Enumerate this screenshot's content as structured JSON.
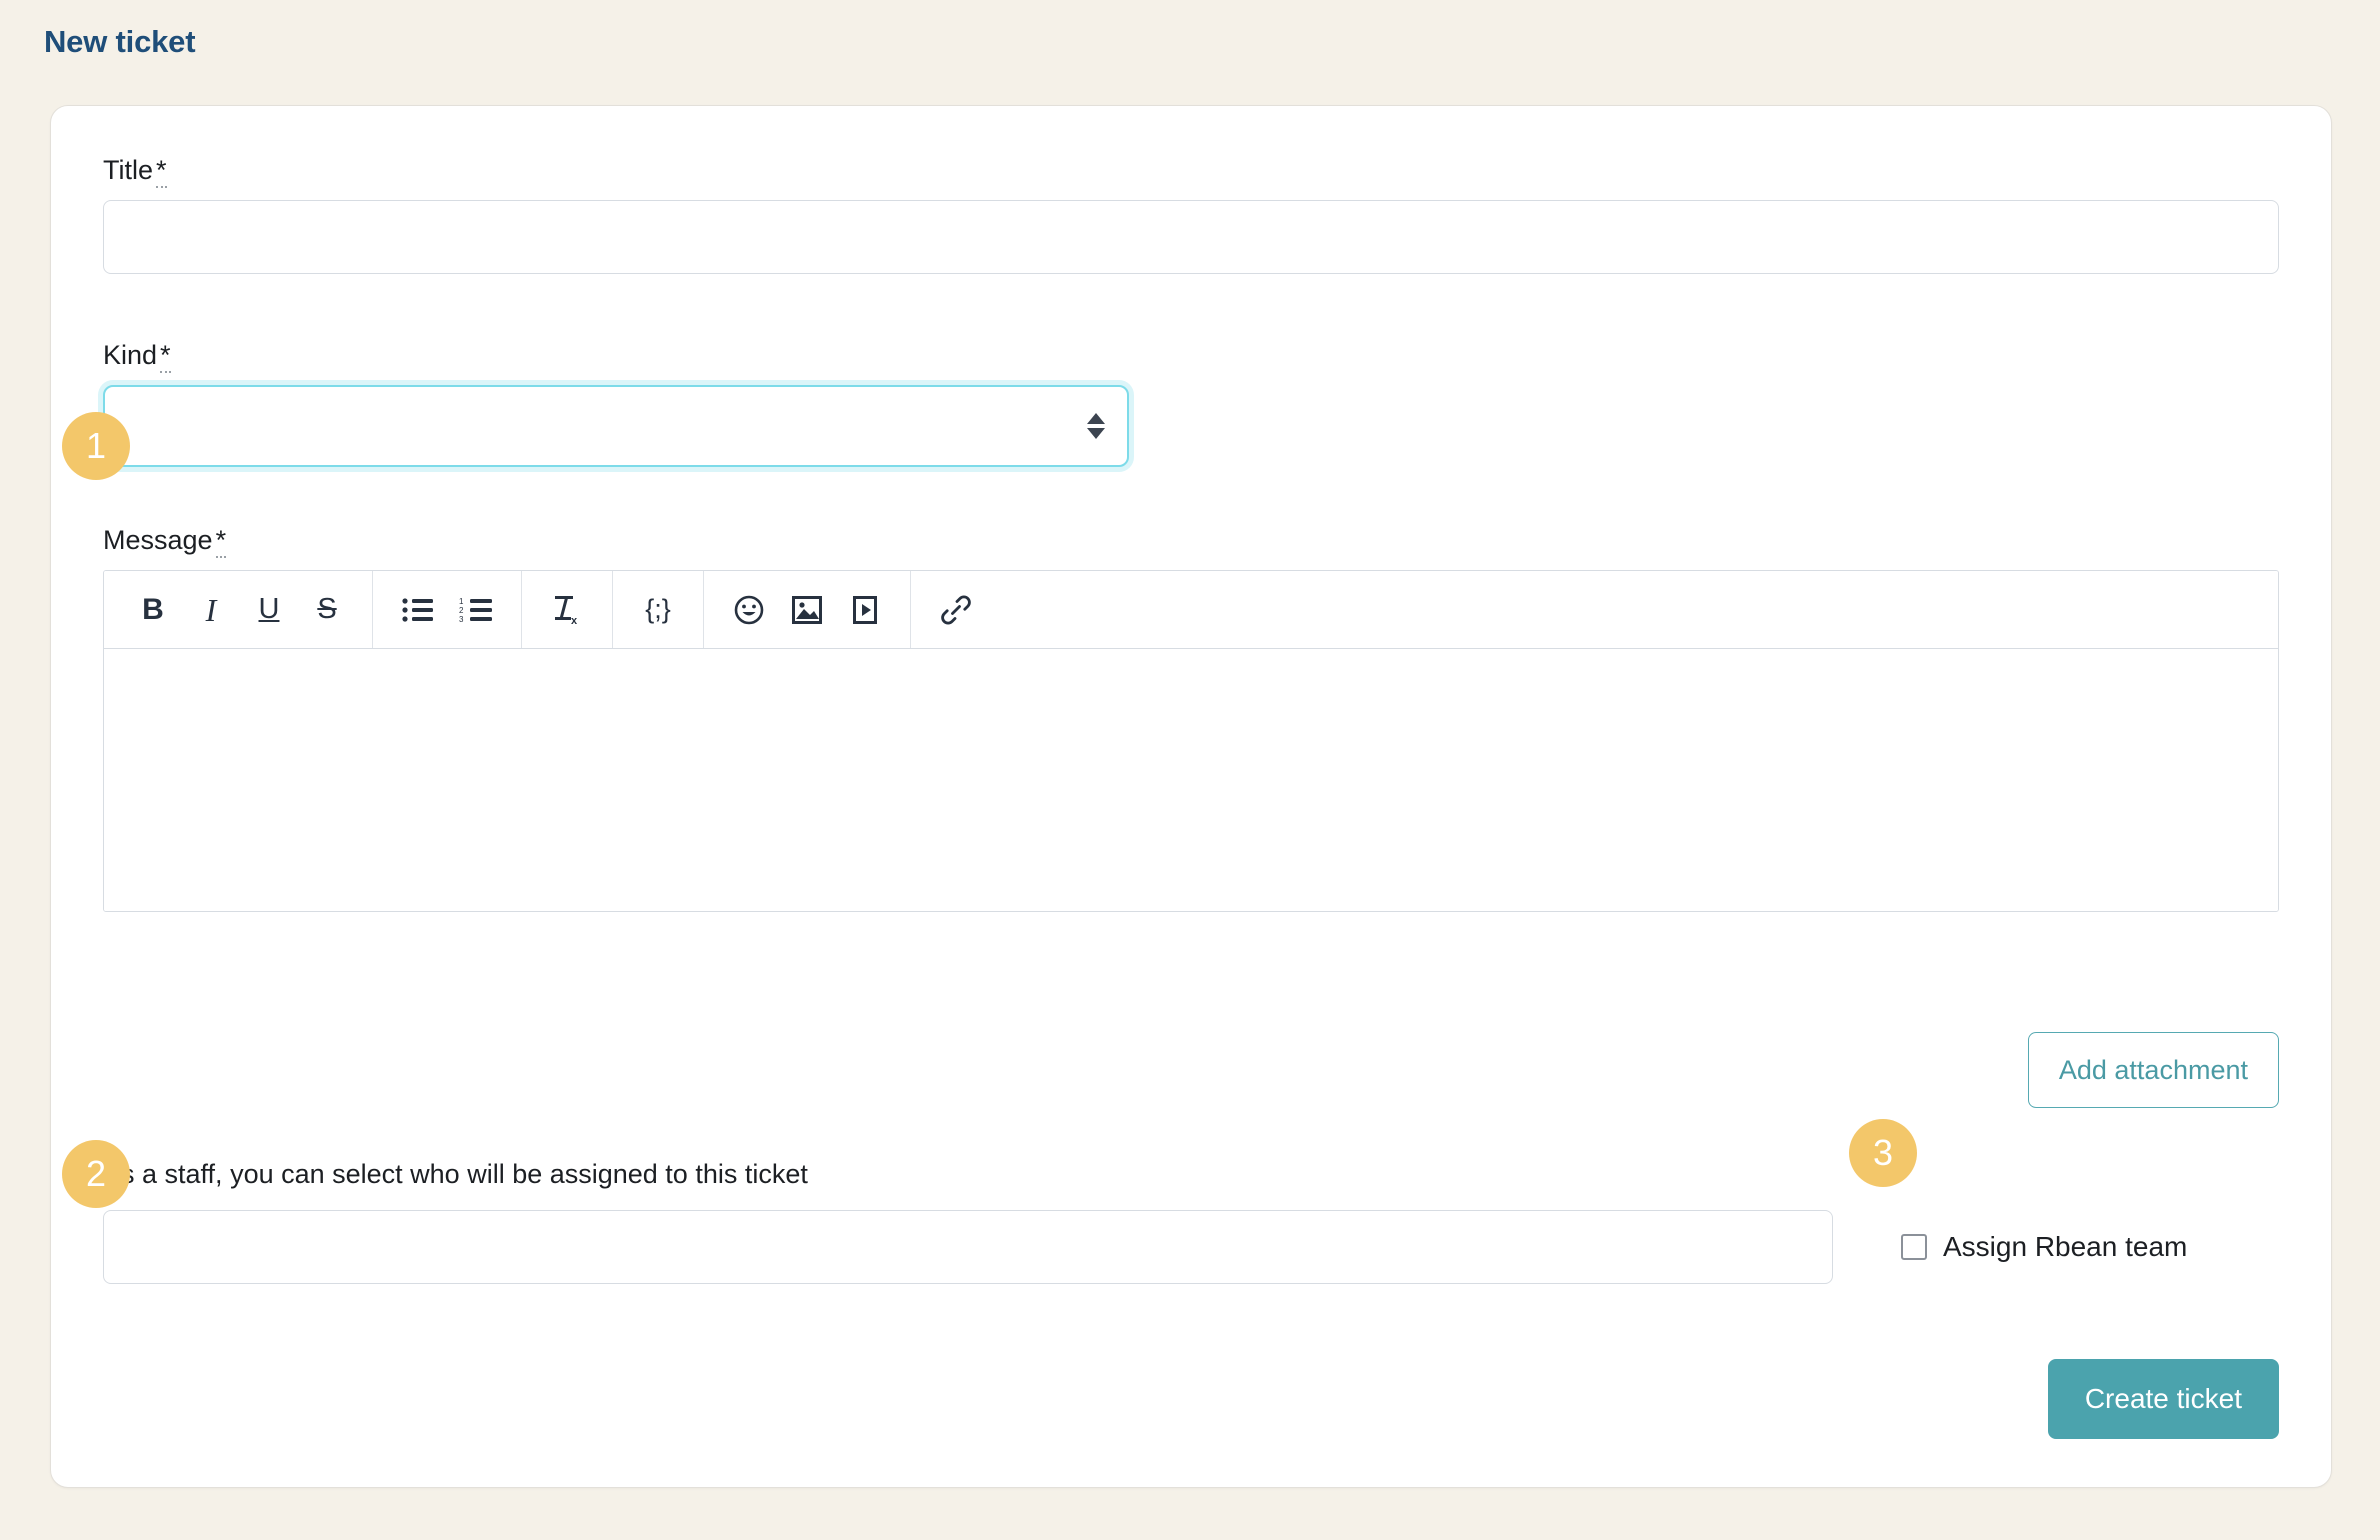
{
  "page": {
    "title": "New ticket",
    "background_color": "#f5f1e8",
    "title_color": "#1f4e79"
  },
  "form": {
    "title_field": {
      "label": "Title",
      "required_marker": "*",
      "value": "",
      "placeholder": ""
    },
    "kind_field": {
      "label": "Kind",
      "required_marker": "*",
      "selected_value": "",
      "options": [
        ""
      ],
      "focused": true,
      "focus_color": "#7ddbe9"
    },
    "message_field": {
      "label": "Message",
      "required_marker": "*",
      "value": "",
      "toolbar_groups": [
        {
          "buttons": [
            {
              "name": "bold-icon",
              "glyph": "B",
              "title": "Bold"
            },
            {
              "name": "italic-icon",
              "glyph": "I",
              "title": "Italic"
            },
            {
              "name": "underline-icon",
              "glyph": "U",
              "title": "Underline"
            },
            {
              "name": "strikethrough-icon",
              "glyph": "S",
              "title": "Strikethrough"
            }
          ]
        },
        {
          "buttons": [
            {
              "name": "bulleted-list-icon",
              "glyph": "",
              "title": "Bulleted list"
            },
            {
              "name": "numbered-list-icon",
              "glyph": "",
              "title": "Numbered list"
            }
          ]
        },
        {
          "buttons": [
            {
              "name": "remove-format-icon",
              "glyph": "",
              "title": "Remove format"
            }
          ]
        },
        {
          "buttons": [
            {
              "name": "code-block-icon",
              "glyph": "{;}",
              "title": "Code block"
            }
          ]
        },
        {
          "buttons": [
            {
              "name": "emoji-icon",
              "glyph": "",
              "title": "Emoji"
            },
            {
              "name": "image-icon",
              "glyph": "",
              "title": "Insert image"
            },
            {
              "name": "video-icon",
              "glyph": "",
              "title": "Insert video"
            }
          ]
        },
        {
          "buttons": [
            {
              "name": "link-icon",
              "glyph": "",
              "title": "Insert link"
            }
          ]
        }
      ]
    },
    "add_attachment_button": {
      "label": "Add attachment",
      "color": "#4a9aa4"
    },
    "staff_assignment": {
      "hint": "As a staff, you can select who will be assigned to this ticket",
      "assignee_value": "",
      "assignee_placeholder": "",
      "checkbox_label": "Assign Rbean team",
      "checkbox_checked": false
    },
    "submit_button": {
      "label": "Create ticket",
      "background_color": "#4ba3ad"
    }
  },
  "step_badges": [
    {
      "number": "1",
      "target": "kind-select"
    },
    {
      "number": "2",
      "target": "assignee-input"
    },
    {
      "number": "3",
      "target": "assign-team-checkbox"
    }
  ]
}
